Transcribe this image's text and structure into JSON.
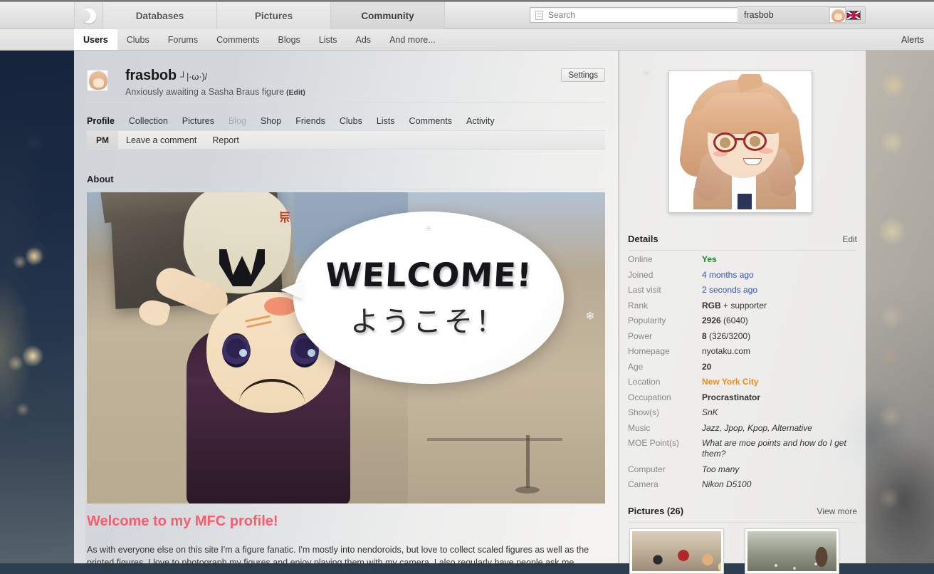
{
  "topnav": {
    "logo_icon": "crescent-moon-icon",
    "items": [
      {
        "label": "Databases"
      },
      {
        "label": "Pictures"
      },
      {
        "label": "Community"
      }
    ],
    "search": {
      "placeholder": "Search",
      "value": "",
      "icon": "list-search-icon"
    },
    "user": {
      "name": "frasbob",
      "avatar_icon": "user-avatar",
      "flag_icon": "uk-flag-icon"
    }
  },
  "subnav": {
    "tabs": [
      {
        "label": "Users",
        "active": true
      },
      {
        "label": "Clubs",
        "active": false
      },
      {
        "label": "Forums",
        "active": false
      },
      {
        "label": "Comments",
        "active": false
      },
      {
        "label": "Blogs",
        "active": false
      },
      {
        "label": "Lists",
        "active": false
      },
      {
        "label": "Ads",
        "active": false
      },
      {
        "label": "And more...",
        "active": false
      }
    ],
    "alerts_label": "Alerts"
  },
  "profile": {
    "name": "frasbob",
    "kaomoji": "┘|·ω·)/",
    "tagline": "Anxiously awaiting a Sasha Braus figure",
    "tagline_edit": "(Edit)",
    "settings_label": "Settings",
    "tabs": [
      {
        "label": "Profile",
        "state": "active"
      },
      {
        "label": "Collection",
        "state": "normal"
      },
      {
        "label": "Pictures",
        "state": "normal"
      },
      {
        "label": "Blog",
        "state": "dim"
      },
      {
        "label": "Shop",
        "state": "normal"
      },
      {
        "label": "Friends",
        "state": "normal"
      },
      {
        "label": "Clubs",
        "state": "normal"
      },
      {
        "label": "Lists",
        "state": "normal"
      },
      {
        "label": "Comments",
        "state": "normal"
      },
      {
        "label": "Activity",
        "state": "normal"
      }
    ],
    "actions": {
      "pm_label": "PM",
      "comment_label": "Leave a comment",
      "report_label": "Report"
    }
  },
  "about": {
    "heading": "About",
    "hero": {
      "bubble_en": "WELCOME!",
      "bubble_jp": "ようこそ！",
      "stamp": "当",
      "snowflake": "❄"
    },
    "welcome_heading": "Welcome to my MFC profile!",
    "welcome_paragraph": "As with everyone else on this site I'm a figure fanatic. I'm mostly into nendoroids, but love to collect scaled figures as well as the printed figures. I love to photograph my figures and enjoy playing them with my camera. I also regularly have people ask me"
  },
  "sidebar": {
    "gear_icon": "gear-icon",
    "avatar_name": "profile-avatar-image",
    "details": {
      "heading": "Details",
      "edit_label": "Edit",
      "rows": [
        {
          "key": "Online",
          "value": "Yes",
          "style": "green"
        },
        {
          "key": "Joined",
          "value": "4 months ago",
          "style": "link"
        },
        {
          "key": "Last visit",
          "value": "2 seconds ago",
          "style": "link"
        },
        {
          "key": "Rank",
          "value": "RGB + supporter",
          "style": "rank"
        },
        {
          "key": "Popularity",
          "value": "2926 (6040)",
          "style": "stat"
        },
        {
          "key": "Power",
          "value": "8 (326/3200)",
          "style": "stat"
        },
        {
          "key": "Homepage",
          "value": "nyotaku.com",
          "style": "plain"
        },
        {
          "key": "Age",
          "value": "20",
          "style": "bold"
        },
        {
          "key": "Location",
          "value": "New York City",
          "style": "orange"
        },
        {
          "key": "Occupation",
          "value": "Procrastinator",
          "style": "bold"
        },
        {
          "key": "Show(s)",
          "value": "SnK",
          "style": "ital"
        },
        {
          "key": "Music",
          "value": "Jazz, Jpop, Kpop, Alternative",
          "style": "ital"
        },
        {
          "key": "MOE Point(s)",
          "value": "What are moe points and how do I get them?",
          "style": "ital"
        },
        {
          "key": "Computer",
          "value": "Too many",
          "style": "ital"
        },
        {
          "key": "Camera",
          "value": "Nikon D5100",
          "style": "ital"
        }
      ],
      "rank_bold": "RGB",
      "rank_rest": " + supporter",
      "popularity_bold": "2926",
      "popularity_rest": " (6040)",
      "power_bold": "8",
      "power_rest": " (326/3200)"
    },
    "pictures": {
      "heading": "Pictures (26)",
      "view_more_label": "View more",
      "thumbs": [
        {
          "name": "picture-thumbnail-1"
        },
        {
          "name": "picture-thumbnail-2"
        }
      ]
    }
  }
}
